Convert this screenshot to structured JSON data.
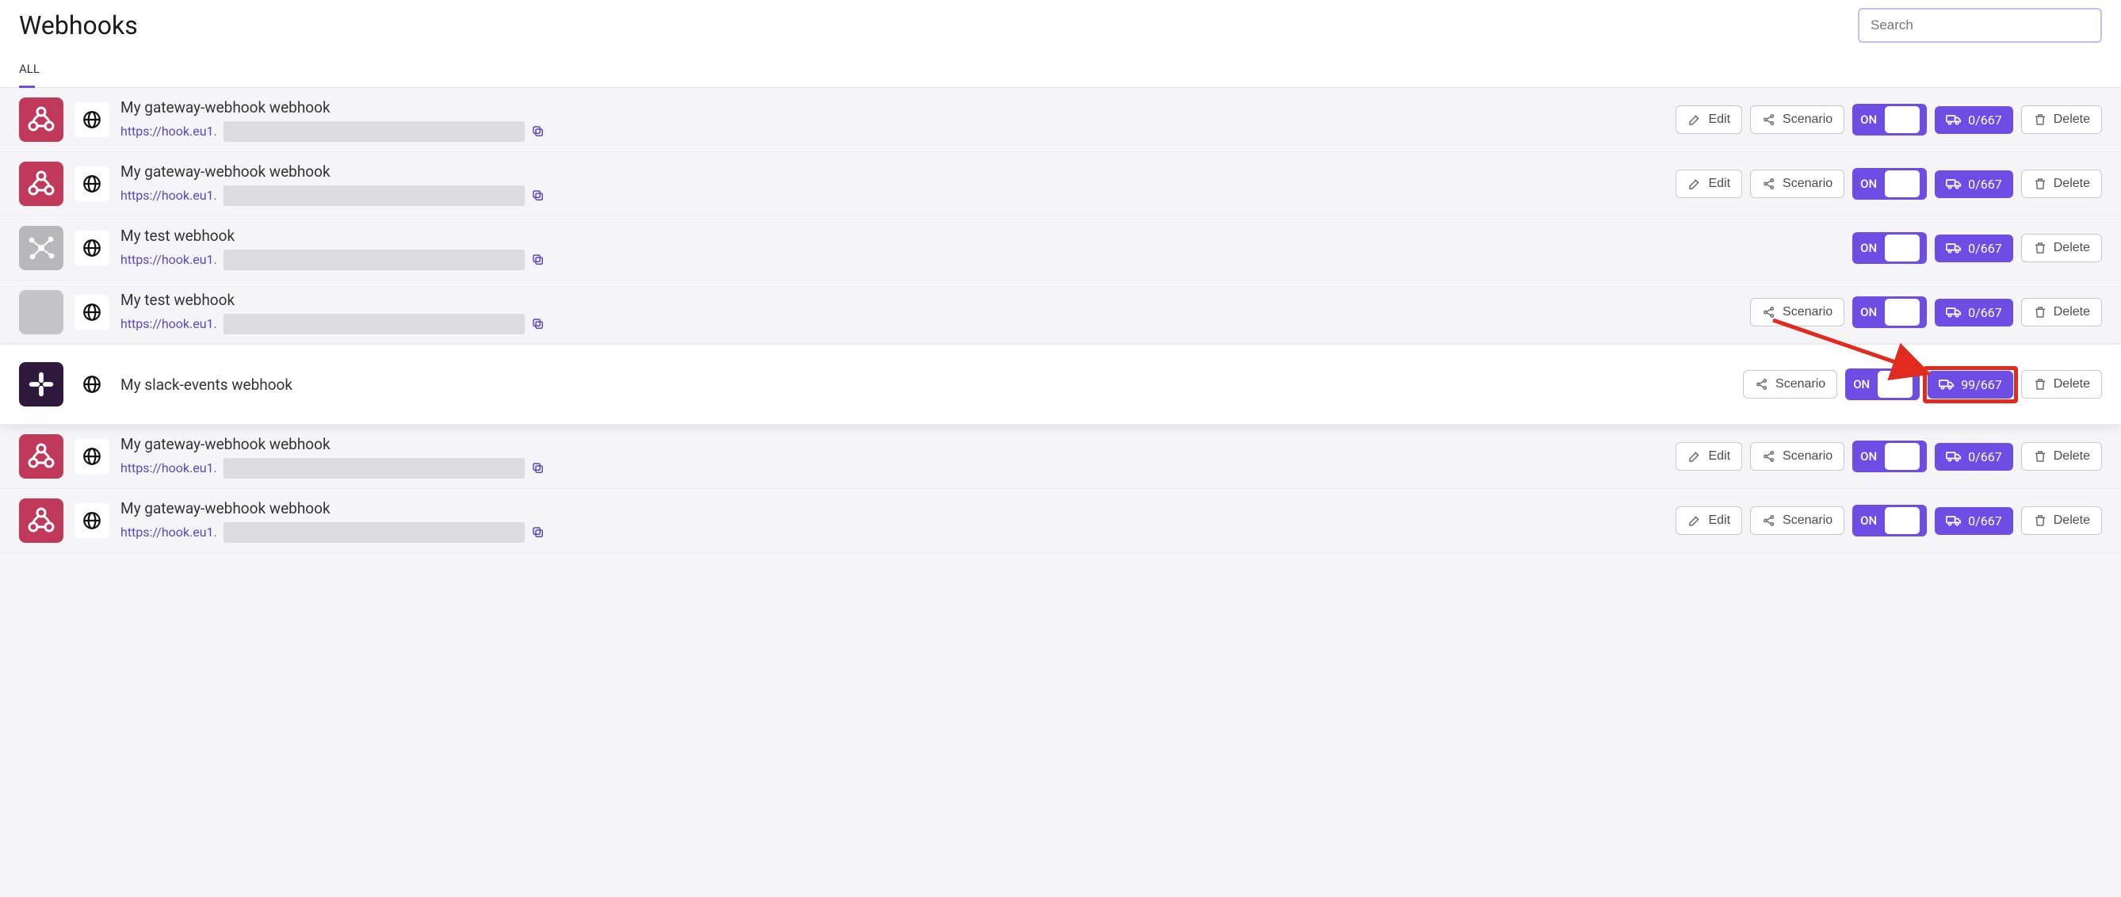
{
  "header": {
    "title": "Webhooks",
    "search_placeholder": "Search",
    "tab_all": "ALL"
  },
  "labels": {
    "edit": "Edit",
    "scenario": "Scenario",
    "toggle_on": "ON",
    "delete": "Delete"
  },
  "rows": [
    {
      "title": "My gateway-webhook webhook",
      "url_prefix": "https://hook.eu1.",
      "icon": "gateway",
      "show_url": true,
      "show_edit": true,
      "show_scenario": true,
      "queue": "0/667",
      "highlight": false,
      "queue_boxed": false
    },
    {
      "title": "My gateway-webhook webhook",
      "url_prefix": "https://hook.eu1.",
      "icon": "gateway",
      "show_url": true,
      "show_edit": true,
      "show_scenario": true,
      "queue": "0/667",
      "highlight": false,
      "queue_boxed": false
    },
    {
      "title": "My test webhook",
      "url_prefix": "https://hook.eu1.",
      "icon": "test",
      "show_url": true,
      "show_edit": false,
      "show_scenario": false,
      "queue": "0/667",
      "highlight": false,
      "queue_boxed": false
    },
    {
      "title": "My test webhook",
      "url_prefix": "https://hook.eu1.",
      "icon": "blank",
      "show_url": true,
      "show_edit": false,
      "show_scenario": true,
      "queue": "0/667",
      "highlight": false,
      "queue_boxed": false
    },
    {
      "title": "My slack-events webhook",
      "url_prefix": "",
      "icon": "slack",
      "show_url": false,
      "show_edit": false,
      "show_scenario": true,
      "queue": "99/667",
      "highlight": true,
      "queue_boxed": true
    },
    {
      "title": "My gateway-webhook webhook",
      "url_prefix": "https://hook.eu1.",
      "icon": "gateway",
      "show_url": true,
      "show_edit": true,
      "show_scenario": true,
      "queue": "0/667",
      "highlight": false,
      "queue_boxed": false
    },
    {
      "title": "My gateway-webhook webhook",
      "url_prefix": "https://hook.eu1.",
      "icon": "gateway",
      "show_url": true,
      "show_edit": true,
      "show_scenario": true,
      "queue": "0/667",
      "highlight": false,
      "queue_boxed": false
    }
  ]
}
